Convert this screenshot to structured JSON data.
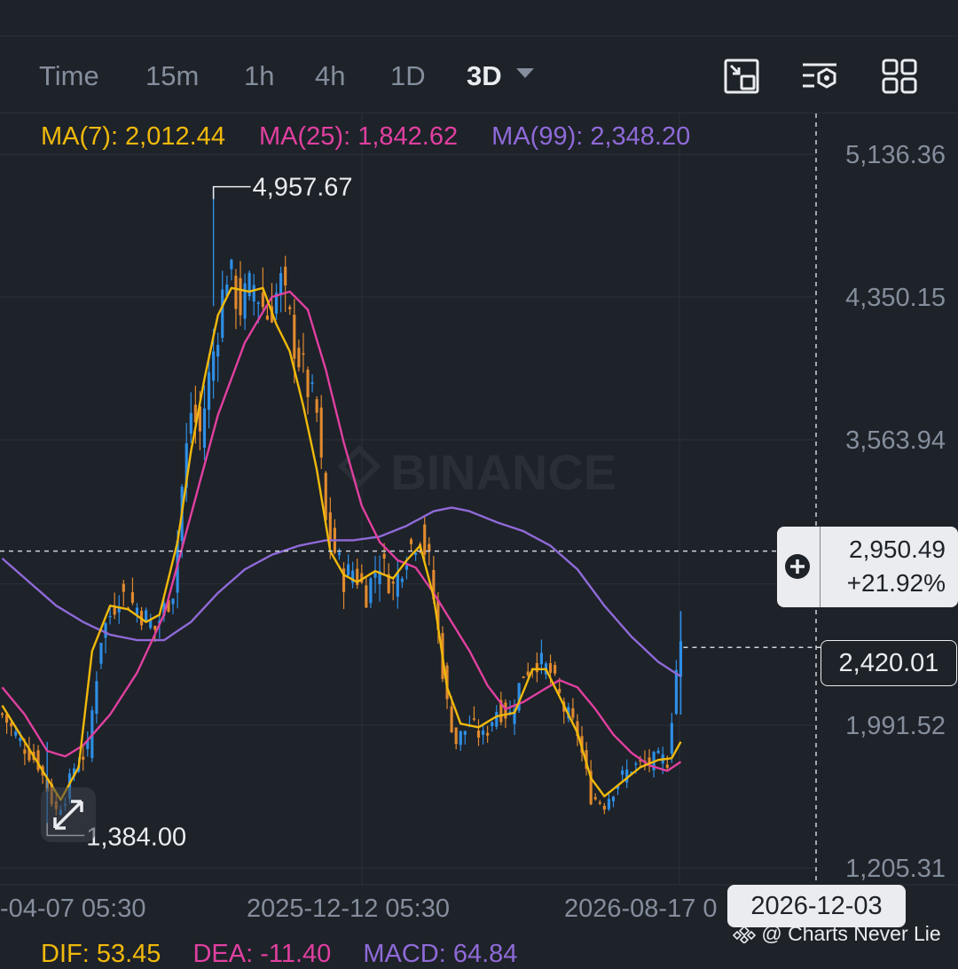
{
  "timeframes": [
    {
      "label": "Time",
      "active": false
    },
    {
      "label": "15m",
      "active": false
    },
    {
      "label": "1h",
      "active": false
    },
    {
      "label": "4h",
      "active": false
    },
    {
      "label": "1D",
      "active": false
    },
    {
      "label": "3D",
      "active": true
    }
  ],
  "toolbar_icons": [
    "fullscreen-exit-icon",
    "indicator-settings-icon",
    "grid-layout-icon"
  ],
  "moving_averages": [
    {
      "label": "MA(7): 2,012.44",
      "color": "#f0b90b"
    },
    {
      "label": "MA(25): 1,842.62",
      "color": "#e040a0"
    },
    {
      "label": "MA(99): 2,348.20",
      "color": "#8f6ad8"
    }
  ],
  "price_axis_labels": [
    "5,136.36",
    "4,350.15",
    "3,563.94",
    "1,991.52",
    "1,205.31"
  ],
  "date_axis_labels": [
    "-04-07 05:30",
    "2025-12-12 05:30",
    "2026-08-17 0"
  ],
  "high_marker": "4,957.67",
  "low_marker": "1,384.00",
  "crosshair": {
    "price": "2,950.49",
    "change": "+21.92%",
    "date": "2026-12-03"
  },
  "last_price": "2,420.01",
  "watermark": "BINANCE",
  "attribution": "@ Charts Never Lie",
  "macd": [
    {
      "label": "DIF: 53.45",
      "color": "#f0b90b"
    },
    {
      "label": "DEA: -11.40",
      "color": "#e040a0"
    },
    {
      "label": "MACD: 64.84",
      "color": "#8f6ad8"
    }
  ],
  "colors": {
    "background": "#1e2229",
    "grid": "#2b3139",
    "up": "#2e8fe6",
    "down": "#e08a2e",
    "ma7": "#f0b90b",
    "ma25": "#e040a0",
    "ma99": "#8f6ad8"
  },
  "chart_data": {
    "type": "candlestick",
    "title": "",
    "y_axis_ticks": [
      5136.36,
      4350.15,
      3563.94,
      1991.52,
      1205.31
    ],
    "x_axis_ticks": [
      "-04-07 05:30",
      "2025-12-12 05:30",
      "2026-08-17 0"
    ],
    "high": 4957.67,
    "low": 1384.0,
    "last": 2420.01,
    "close_trend": [
      {
        "i": 0,
        "v": 2050
      },
      {
        "i": 4,
        "v": 1900
      },
      {
        "i": 8,
        "v": 1780
      },
      {
        "i": 10,
        "v": 1640
      },
      {
        "i": 12,
        "v": 1520
      },
      {
        "i": 14,
        "v": 1600
      },
      {
        "i": 16,
        "v": 1760
      },
      {
        "i": 19,
        "v": 1860
      },
      {
        "i": 22,
        "v": 2480
      },
      {
        "i": 26,
        "v": 2720
      },
      {
        "i": 30,
        "v": 2640
      },
      {
        "i": 34,
        "v": 2520
      },
      {
        "i": 38,
        "v": 2740
      },
      {
        "i": 40,
        "v": 3300
      },
      {
        "i": 42,
        "v": 3720
      },
      {
        "i": 44,
        "v": 3600
      },
      {
        "i": 47,
        "v": 4050
      },
      {
        "i": 50,
        "v": 4500
      },
      {
        "i": 53,
        "v": 4300
      },
      {
        "i": 56,
        "v": 4420
      },
      {
        "i": 59,
        "v": 4250
      },
      {
        "i": 62,
        "v": 4420
      },
      {
        "i": 65,
        "v": 4100
      },
      {
        "i": 68,
        "v": 3850
      },
      {
        "i": 70,
        "v": 3700
      },
      {
        "i": 72,
        "v": 3100
      },
      {
        "i": 74,
        "v": 2950
      },
      {
        "i": 76,
        "v": 2800
      },
      {
        "i": 78,
        "v": 2850
      },
      {
        "i": 81,
        "v": 2720
      },
      {
        "i": 84,
        "v": 2900
      },
      {
        "i": 87,
        "v": 2750
      },
      {
        "i": 90,
        "v": 2950
      },
      {
        "i": 93,
        "v": 3050
      },
      {
        "i": 95,
        "v": 2880
      },
      {
        "i": 97,
        "v": 2500
      },
      {
        "i": 99,
        "v": 2100
      },
      {
        "i": 101,
        "v": 1900
      },
      {
        "i": 104,
        "v": 2000
      },
      {
        "i": 107,
        "v": 1920
      },
      {
        "i": 110,
        "v": 2080
      },
      {
        "i": 113,
        "v": 2050
      },
      {
        "i": 116,
        "v": 2280
      },
      {
        "i": 119,
        "v": 2350
      },
      {
        "i": 122,
        "v": 2280
      },
      {
        "i": 125,
        "v": 2080
      },
      {
        "i": 128,
        "v": 1950
      },
      {
        "i": 131,
        "v": 1600
      },
      {
        "i": 134,
        "v": 1560
      },
      {
        "i": 137,
        "v": 1680
      },
      {
        "i": 140,
        "v": 1760
      },
      {
        "i": 143,
        "v": 1780
      },
      {
        "i": 146,
        "v": 1800
      },
      {
        "i": 148,
        "v": 1800
      },
      {
        "i": 150,
        "v": 2300
      },
      {
        "i": 151,
        "v": 2420
      }
    ],
    "ma7_trend": [
      {
        "i": 0,
        "v": 2100
      },
      {
        "i": 6,
        "v": 1860
      },
      {
        "i": 10,
        "v": 1700
      },
      {
        "i": 13,
        "v": 1580
      },
      {
        "i": 17,
        "v": 1760
      },
      {
        "i": 20,
        "v": 2400
      },
      {
        "i": 24,
        "v": 2650
      },
      {
        "i": 28,
        "v": 2630
      },
      {
        "i": 32,
        "v": 2560
      },
      {
        "i": 35,
        "v": 2600
      },
      {
        "i": 39,
        "v": 3000
      },
      {
        "i": 42,
        "v": 3500
      },
      {
        "i": 45,
        "v": 3900
      },
      {
        "i": 48,
        "v": 4250
      },
      {
        "i": 51,
        "v": 4400
      },
      {
        "i": 55,
        "v": 4380
      },
      {
        "i": 58,
        "v": 4400
      },
      {
        "i": 61,
        "v": 4200
      },
      {
        "i": 64,
        "v": 4050
      },
      {
        "i": 67,
        "v": 3750
      },
      {
        "i": 70,
        "v": 3400
      },
      {
        "i": 73,
        "v": 2950
      },
      {
        "i": 76,
        "v": 2820
      },
      {
        "i": 79,
        "v": 2780
      },
      {
        "i": 83,
        "v": 2840
      },
      {
        "i": 87,
        "v": 2800
      },
      {
        "i": 90,
        "v": 2900
      },
      {
        "i": 93,
        "v": 2980
      },
      {
        "i": 96,
        "v": 2700
      },
      {
        "i": 99,
        "v": 2200
      },
      {
        "i": 102,
        "v": 2000
      },
      {
        "i": 106,
        "v": 1980
      },
      {
        "i": 110,
        "v": 2040
      },
      {
        "i": 114,
        "v": 2060
      },
      {
        "i": 118,
        "v": 2300
      },
      {
        "i": 121,
        "v": 2300
      },
      {
        "i": 124,
        "v": 2150
      },
      {
        "i": 128,
        "v": 1950
      },
      {
        "i": 131,
        "v": 1700
      },
      {
        "i": 134,
        "v": 1600
      },
      {
        "i": 138,
        "v": 1680
      },
      {
        "i": 142,
        "v": 1760
      },
      {
        "i": 146,
        "v": 1800
      },
      {
        "i": 149,
        "v": 1810
      },
      {
        "i": 151,
        "v": 1900
      }
    ],
    "ma25_trend": [
      {
        "i": 0,
        "v": 2200
      },
      {
        "i": 5,
        "v": 2050
      },
      {
        "i": 10,
        "v": 1850
      },
      {
        "i": 14,
        "v": 1820
      },
      {
        "i": 18,
        "v": 1880
      },
      {
        "i": 24,
        "v": 2050
      },
      {
        "i": 30,
        "v": 2280
      },
      {
        "i": 36,
        "v": 2600
      },
      {
        "i": 42,
        "v": 3150
      },
      {
        "i": 48,
        "v": 3700
      },
      {
        "i": 54,
        "v": 4100
      },
      {
        "i": 60,
        "v": 4350
      },
      {
        "i": 64,
        "v": 4380
      },
      {
        "i": 68,
        "v": 4280
      },
      {
        "i": 72,
        "v": 3950
      },
      {
        "i": 76,
        "v": 3550
      },
      {
        "i": 80,
        "v": 3200
      },
      {
        "i": 84,
        "v": 3000
      },
      {
        "i": 88,
        "v": 2900
      },
      {
        "i": 92,
        "v": 2860
      },
      {
        "i": 96,
        "v": 2720
      },
      {
        "i": 100,
        "v": 2560
      },
      {
        "i": 104,
        "v": 2400
      },
      {
        "i": 108,
        "v": 2210
      },
      {
        "i": 112,
        "v": 2080
      },
      {
        "i": 116,
        "v": 2120
      },
      {
        "i": 120,
        "v": 2180
      },
      {
        "i": 124,
        "v": 2240
      },
      {
        "i": 128,
        "v": 2200
      },
      {
        "i": 132,
        "v": 2080
      },
      {
        "i": 136,
        "v": 1940
      },
      {
        "i": 140,
        "v": 1840
      },
      {
        "i": 144,
        "v": 1770
      },
      {
        "i": 148,
        "v": 1740
      },
      {
        "i": 151,
        "v": 1790
      }
    ],
    "ma99_trend": [
      {
        "i": 0,
        "v": 2910
      },
      {
        "i": 6,
        "v": 2780
      },
      {
        "i": 12,
        "v": 2650
      },
      {
        "i": 18,
        "v": 2560
      },
      {
        "i": 24,
        "v": 2490
      },
      {
        "i": 30,
        "v": 2460
      },
      {
        "i": 36,
        "v": 2460
      },
      {
        "i": 42,
        "v": 2560
      },
      {
        "i": 48,
        "v": 2720
      },
      {
        "i": 54,
        "v": 2850
      },
      {
        "i": 60,
        "v": 2930
      },
      {
        "i": 66,
        "v": 2980
      },
      {
        "i": 72,
        "v": 3010
      },
      {
        "i": 78,
        "v": 3010
      },
      {
        "i": 84,
        "v": 3030
      },
      {
        "i": 90,
        "v": 3090
      },
      {
        "i": 96,
        "v": 3170
      },
      {
        "i": 100,
        "v": 3190
      },
      {
        "i": 104,
        "v": 3170
      },
      {
        "i": 110,
        "v": 3110
      },
      {
        "i": 116,
        "v": 3060
      },
      {
        "i": 122,
        "v": 2980
      },
      {
        "i": 128,
        "v": 2850
      },
      {
        "i": 134,
        "v": 2650
      },
      {
        "i": 140,
        "v": 2480
      },
      {
        "i": 146,
        "v": 2340
      },
      {
        "i": 151,
        "v": 2260
      }
    ]
  }
}
